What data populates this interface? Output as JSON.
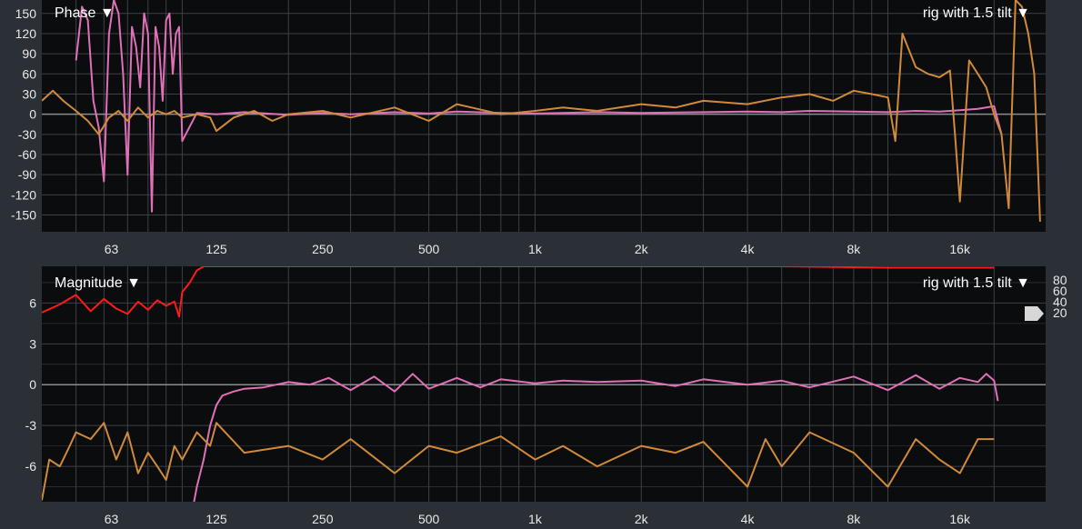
{
  "colors": {
    "background": "#2b3036",
    "plot": "#0b0c0d",
    "grid": "#3d4148",
    "zero_line": "#8a8d92",
    "coherence": "#ff1a1a",
    "measurement": "#e070b8",
    "reference": "#d08a3a",
    "text": "#e8e8e8"
  },
  "icons": {
    "dropdown": "triangle-down-icon",
    "slider": "slider-handle-icon"
  },
  "phase_panel": {
    "title": "Phase ▼",
    "trace_menu": "rig with 1.5 tilt ▼"
  },
  "magnitude_panel": {
    "title": "Magnitude ▼",
    "trace_menu": "rig with 1.5 tilt ▼",
    "coherence_scale": [
      "80",
      "60",
      "40",
      "20"
    ]
  },
  "chart_data": [
    {
      "type": "line",
      "panel": "phase",
      "x_scale": "log",
      "xlim": [
        40,
        28000
      ],
      "ylim": [
        -175,
        170
      ],
      "grid": true,
      "x_ticks": [
        63,
        125,
        250,
        500,
        1000,
        2000,
        4000,
        8000,
        16000
      ],
      "x_tick_labels": [
        "63",
        "125",
        "250",
        "500",
        "1k",
        "2k",
        "4k",
        "8k",
        "16k"
      ],
      "y_ticks": [
        150,
        120,
        90,
        60,
        30,
        0,
        -30,
        -60,
        -90,
        -120,
        -150
      ],
      "y_tick_labels": [
        "150",
        "120",
        "90",
        "60",
        "30",
        "0",
        "-30",
        "-60",
        "-90",
        "-120",
        "-150"
      ],
      "series": [
        {
          "color": "#e070b8",
          "x": [
            50,
            52,
            54,
            56,
            58,
            60,
            62,
            64,
            66,
            68,
            70,
            72,
            74,
            76,
            78,
            80,
            82,
            84,
            86,
            88,
            90,
            92,
            94,
            96,
            98,
            100,
            110,
            125,
            150,
            200,
            250,
            300,
            400,
            500,
            600,
            800,
            1000,
            1500,
            2000,
            3000,
            4000,
            5000,
            6000,
            8000,
            10000,
            12000,
            14000,
            16000,
            18000,
            19000,
            20000,
            21000
          ],
          "y": [
            80,
            160,
            140,
            20,
            -20,
            -100,
            120,
            170,
            150,
            60,
            -90,
            130,
            100,
            40,
            150,
            120,
            -145,
            130,
            100,
            20,
            140,
            150,
            60,
            120,
            130,
            -40,
            2,
            0,
            3,
            -1,
            2,
            0,
            3,
            1,
            4,
            2,
            1,
            3,
            2,
            3,
            4,
            3,
            5,
            4,
            3,
            5,
            4,
            6,
            8,
            10,
            12,
            -30
          ]
        },
        {
          "color": "#d08a3a",
          "x": [
            40,
            43,
            46,
            50,
            54,
            58,
            62,
            66,
            70,
            75,
            80,
            85,
            90,
            95,
            100,
            110,
            120,
            125,
            140,
            160,
            180,
            200,
            250,
            300,
            400,
            500,
            600,
            800,
            1000,
            1200,
            1500,
            2000,
            2500,
            3000,
            4000,
            5000,
            6000,
            7000,
            8000,
            9000,
            10000,
            10500,
            11000,
            12000,
            13000,
            14000,
            15000,
            15500,
            16000,
            17000,
            18000,
            19000,
            20000,
            21000,
            22000,
            23000,
            24000,
            25000,
            26000,
            27000
          ],
          "y": [
            20,
            35,
            20,
            5,
            -10,
            -30,
            -5,
            5,
            -10,
            10,
            -5,
            5,
            0,
            5,
            -5,
            0,
            -5,
            -25,
            -5,
            5,
            -10,
            0,
            5,
            -5,
            10,
            -10,
            15,
            0,
            5,
            10,
            5,
            15,
            10,
            20,
            15,
            25,
            30,
            20,
            35,
            30,
            25,
            -40,
            120,
            70,
            60,
            55,
            65,
            -30,
            -130,
            80,
            60,
            40,
            0,
            -30,
            -140,
            170,
            160,
            120,
            60,
            -160
          ]
        }
      ]
    },
    {
      "type": "line",
      "panel": "magnitude",
      "x_scale": "log",
      "xlim": [
        40,
        28000
      ],
      "ylim": [
        -8.6,
        8.7
      ],
      "grid": true,
      "x_ticks": [
        63,
        125,
        250,
        500,
        1000,
        2000,
        4000,
        8000,
        16000
      ],
      "x_tick_labels": [
        "63",
        "125",
        "250",
        "500",
        "1k",
        "2k",
        "4k",
        "8k",
        "16k"
      ],
      "y_ticks": [
        6,
        3,
        0,
        -3,
        -6
      ],
      "y_tick_labels": [
        "6",
        "3",
        "0",
        "-3",
        "-6"
      ],
      "series": [
        {
          "color": "#ff1a1a",
          "x": [
            40,
            45,
            50,
            55,
            60,
            65,
            70,
            75,
            80,
            85,
            90,
            95,
            98,
            100,
            105,
            110,
            115,
            125,
            150,
            200,
            500,
            1000,
            5000,
            10000,
            20000
          ],
          "y": [
            5.3,
            5.9,
            6.6,
            5.4,
            6.3,
            5.6,
            5.2,
            6.1,
            5.5,
            6.2,
            5.8,
            6.1,
            5.0,
            6.8,
            7.5,
            8.4,
            8.7,
            8.7,
            8.7,
            8.7,
            8.7,
            8.7,
            8.7,
            8.6,
            8.6
          ]
        },
        {
          "color": "#e070b8",
          "x": [
            108,
            110,
            115,
            120,
            125,
            130,
            140,
            150,
            170,
            200,
            230,
            260,
            300,
            350,
            400,
            450,
            500,
            600,
            700,
            800,
            1000,
            1200,
            1500,
            2000,
            2500,
            3000,
            4000,
            5000,
            6000,
            8000,
            10000,
            12000,
            14000,
            16000,
            18000,
            19000,
            20000,
            20500
          ],
          "y": [
            -8.6,
            -7.5,
            -5.5,
            -3.0,
            -1.5,
            -0.8,
            -0.5,
            -0.3,
            -0.2,
            0.2,
            0.0,
            0.5,
            -0.4,
            0.6,
            -0.5,
            0.8,
            -0.3,
            0.5,
            -0.2,
            0.4,
            0.1,
            0.3,
            0.2,
            0.3,
            -0.1,
            0.4,
            0.0,
            0.3,
            -0.2,
            0.6,
            -0.4,
            0.7,
            -0.3,
            0.5,
            0.2,
            0.8,
            0.3,
            -1.2
          ]
        },
        {
          "color": "#d08a3a",
          "x": [
            40,
            42,
            45,
            48,
            50,
            55,
            60,
            65,
            70,
            75,
            80,
            85,
            90,
            95,
            100,
            110,
            120,
            125,
            150,
            200,
            250,
            300,
            400,
            500,
            600,
            800,
            1000,
            1200,
            1500,
            2000,
            2500,
            3000,
            4000,
            4500,
            5000,
            6000,
            8000,
            10000,
            12000,
            14000,
            16000,
            18000,
            20000
          ],
          "y": [
            -8.5,
            -5.5,
            -6.0,
            -4.5,
            -3.5,
            -4.0,
            -2.8,
            -5.5,
            -3.5,
            -6.5,
            -5.0,
            -6.0,
            -7.0,
            -4.5,
            -5.5,
            -3.5,
            -4.5,
            -2.8,
            -5.0,
            -4.5,
            -5.5,
            -4.0,
            -6.5,
            -4.5,
            -5.0,
            -3.8,
            -5.5,
            -4.5,
            -6.0,
            -4.5,
            -5.0,
            -4.2,
            -7.5,
            -4.0,
            -6.0,
            -3.5,
            -5.0,
            -7.5,
            -4.0,
            -5.5,
            -6.5,
            -4.0,
            -4.0
          ]
        }
      ]
    }
  ]
}
